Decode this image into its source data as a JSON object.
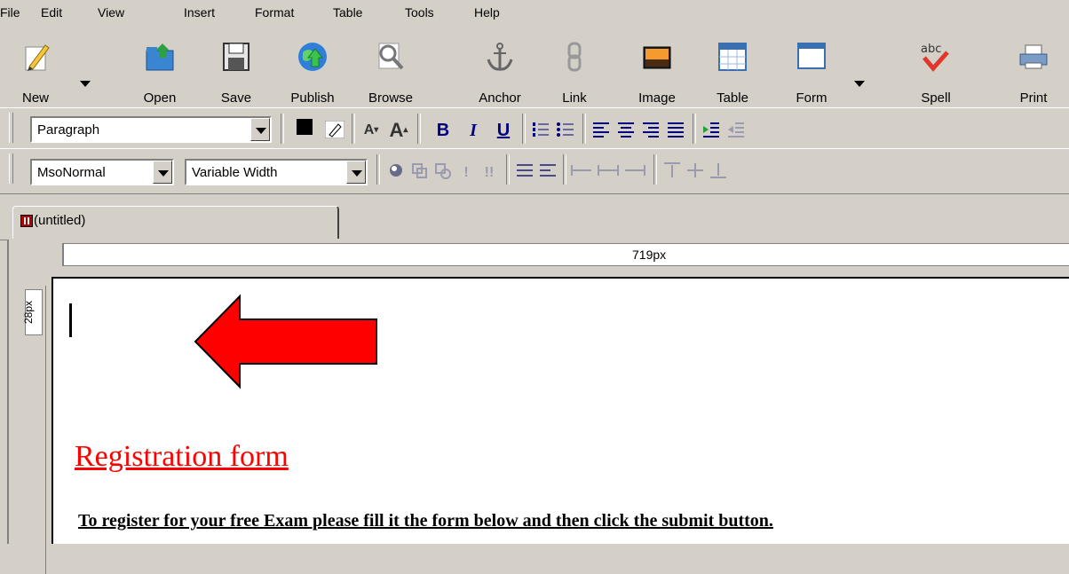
{
  "menu": [
    "File",
    "Edit",
    "View",
    "Insert",
    "Format",
    "Table",
    "Tools",
    "Help"
  ],
  "toolbar": {
    "new": "New",
    "open": "Open",
    "save": "Save",
    "publish": "Publish",
    "browse": "Browse",
    "anchor": "Anchor",
    "link": "Link",
    "image": "Image",
    "table": "Table",
    "form": "Form",
    "spell": "Spell",
    "print": "Print"
  },
  "format": {
    "paragraph_style": "Paragraph",
    "class_style": "MsoNormal",
    "font": "Variable Width",
    "bold": "B",
    "italic": "I",
    "underline": "U"
  },
  "tab": {
    "title": "(untitled)"
  },
  "ruler": {
    "width_label": "719px",
    "height_label": "28px"
  },
  "document": {
    "heading": "Registration form",
    "instruction": "To register for your free Exam please fill it the form below and then click the submit button."
  },
  "colors": {
    "arrow": "#ff0000",
    "heading": "#ff0000",
    "chrome": "#d4d0c8"
  }
}
